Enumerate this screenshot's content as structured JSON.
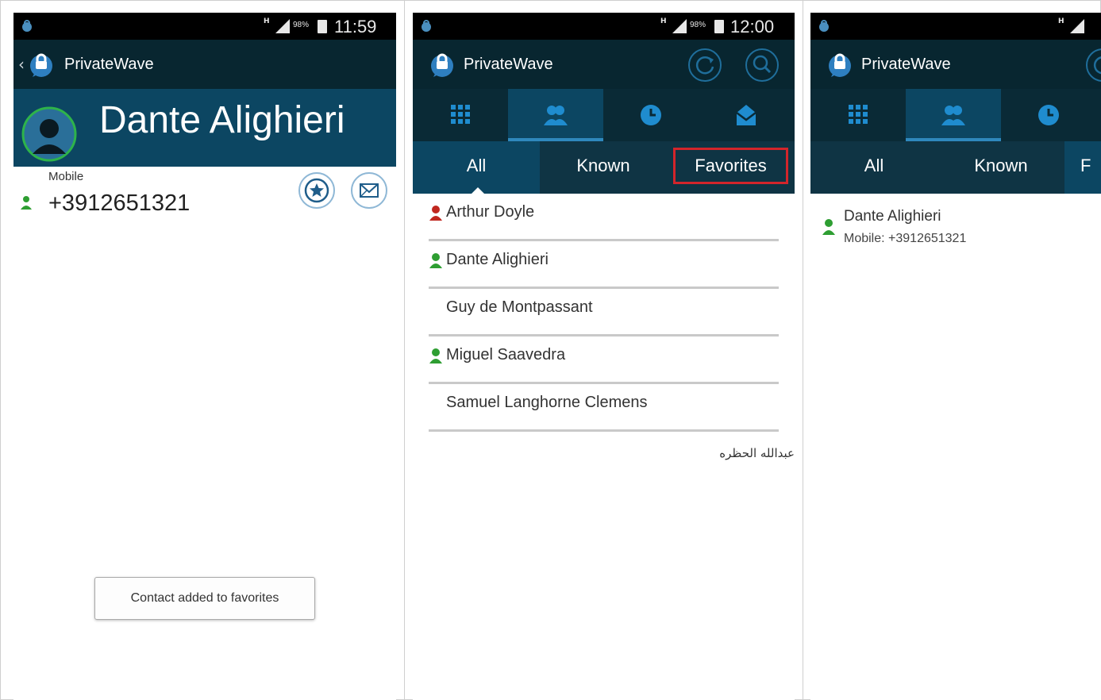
{
  "colors": {
    "statusbar_bg": "#000000",
    "actionbar_bg": "#082630",
    "header_bg": "#0c4662",
    "tab_bg": "#0a2a36",
    "filter_bg": "#0f3444",
    "accent_underline": "#2f88bd",
    "favorite_highlight": "#d3252b",
    "status_green": "#2e9e32",
    "status_red": "#c0271f"
  },
  "screen1": {
    "status": {
      "network": "H",
      "battery": "98%",
      "time": "11:59"
    },
    "app_title": "PrivateWave",
    "contact": {
      "name": "Dante Alighieri",
      "phone_label": "Mobile",
      "phone_number": "+3912651321",
      "favorite_icon": "star-icon",
      "message_icon": "mail-icon"
    },
    "toast": "Contact added to favorites"
  },
  "screen2": {
    "status": {
      "network": "H",
      "battery": "98%",
      "time": "12:00"
    },
    "app_title": "PrivateWave",
    "tabs": [
      "dialpad-icon",
      "contacts-icon",
      "recents-icon",
      "messages-icon"
    ],
    "active_tab": "contacts",
    "filters": [
      "All",
      "Known",
      "Favorites"
    ],
    "active_filter": "All",
    "highlighted_filter": "Favorites",
    "contacts": [
      {
        "name": "Arthur Doyle",
        "status": "red"
      },
      {
        "name": "Dante Alighieri",
        "status": "green"
      },
      {
        "name": "Guy de Montpassant",
        "status": "none"
      },
      {
        "name": "Miguel Saavedra",
        "status": "green"
      },
      {
        "name": "Samuel Langhorne Clemens",
        "status": "none"
      }
    ],
    "extra_entry": "عبدالله الحظره"
  },
  "screen3": {
    "status": {
      "network": "H"
    },
    "app_title": "PrivateWave",
    "filters": [
      "All",
      "Known",
      "F"
    ],
    "favorite": {
      "name": "Dante Alighieri",
      "detail": "Mobile: +3912651321"
    }
  }
}
